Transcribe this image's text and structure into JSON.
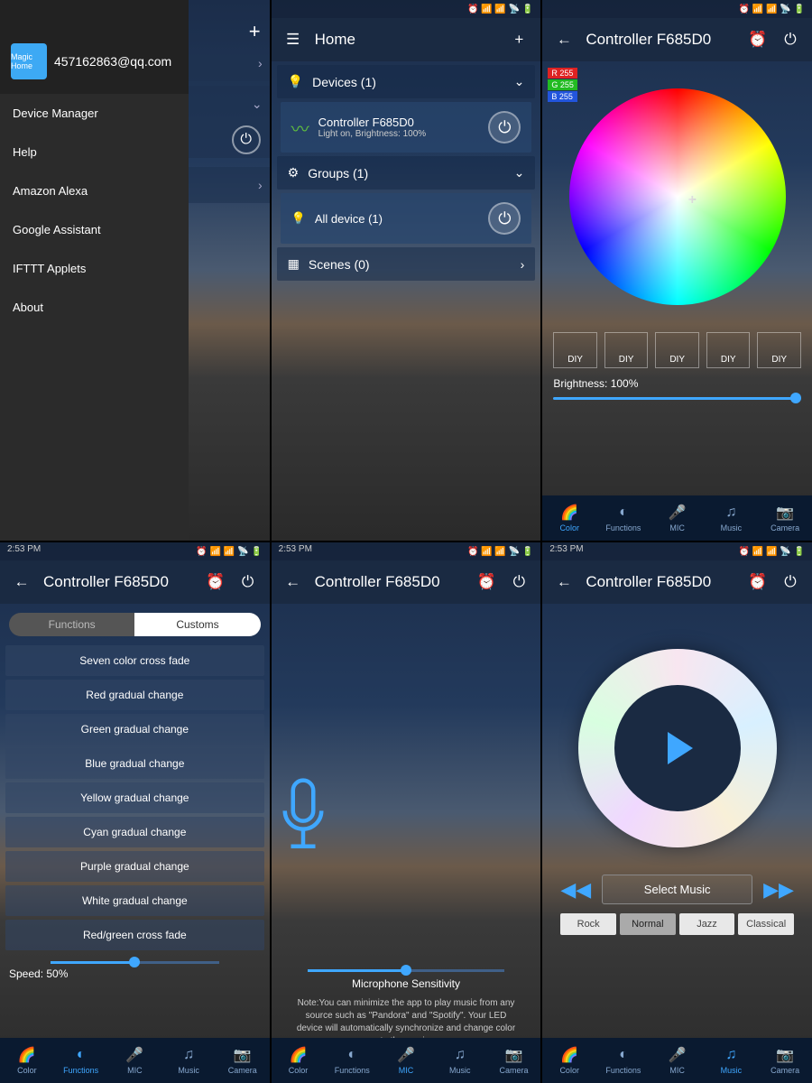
{
  "status_time": "2:53 PM",
  "s1": {
    "email": "457162863@qq.com",
    "logo_text": "Magic Home",
    "menu": [
      "Device Manager",
      "Help",
      "Amazon Alexa",
      "Google Assistant",
      "IFTTT Applets",
      "About"
    ]
  },
  "s2": {
    "title": "Home",
    "sec_devices": "Devices (1)",
    "controller_name": "Controller  F685D0",
    "controller_status": "Light on, Brightness: 100%",
    "sec_groups": "Groups (1)",
    "group_all": "All device (1)",
    "sec_scenes": "Scenes (0)"
  },
  "s3": {
    "title": "Controller  F685D0",
    "rgb": {
      "r": "R 255",
      "g": "G 255",
      "b": "B 255"
    },
    "diy": "DIY",
    "brightness_label": "Brightness: 100%"
  },
  "s4": {
    "title": "Controller  F685D0",
    "seg": {
      "a": "Functions",
      "b": "Customs"
    },
    "items": [
      "Seven color cross fade",
      "Red gradual change",
      "Green gradual change",
      "Blue gradual change",
      "Yellow gradual change",
      "Cyan gradual change",
      "Purple gradual change",
      "White gradual change",
      "Red/green cross fade"
    ],
    "speed": "Speed: 50%"
  },
  "s5": {
    "title": "Controller  F685D0",
    "sens": "Microphone Sensitivity",
    "note": "Note:You can minimize the app to play music from any source such as \"Pandora\" and \"Spotify\". Your LED device will automatically synchronize and change color to the music."
  },
  "s6": {
    "title": "Controller  F685D0",
    "select": "Select Music",
    "genres": [
      "Rock",
      "Normal",
      "Jazz",
      "Classical"
    ]
  },
  "tabs": [
    "Color",
    "Functions",
    "MIC",
    "Music",
    "Camera"
  ]
}
